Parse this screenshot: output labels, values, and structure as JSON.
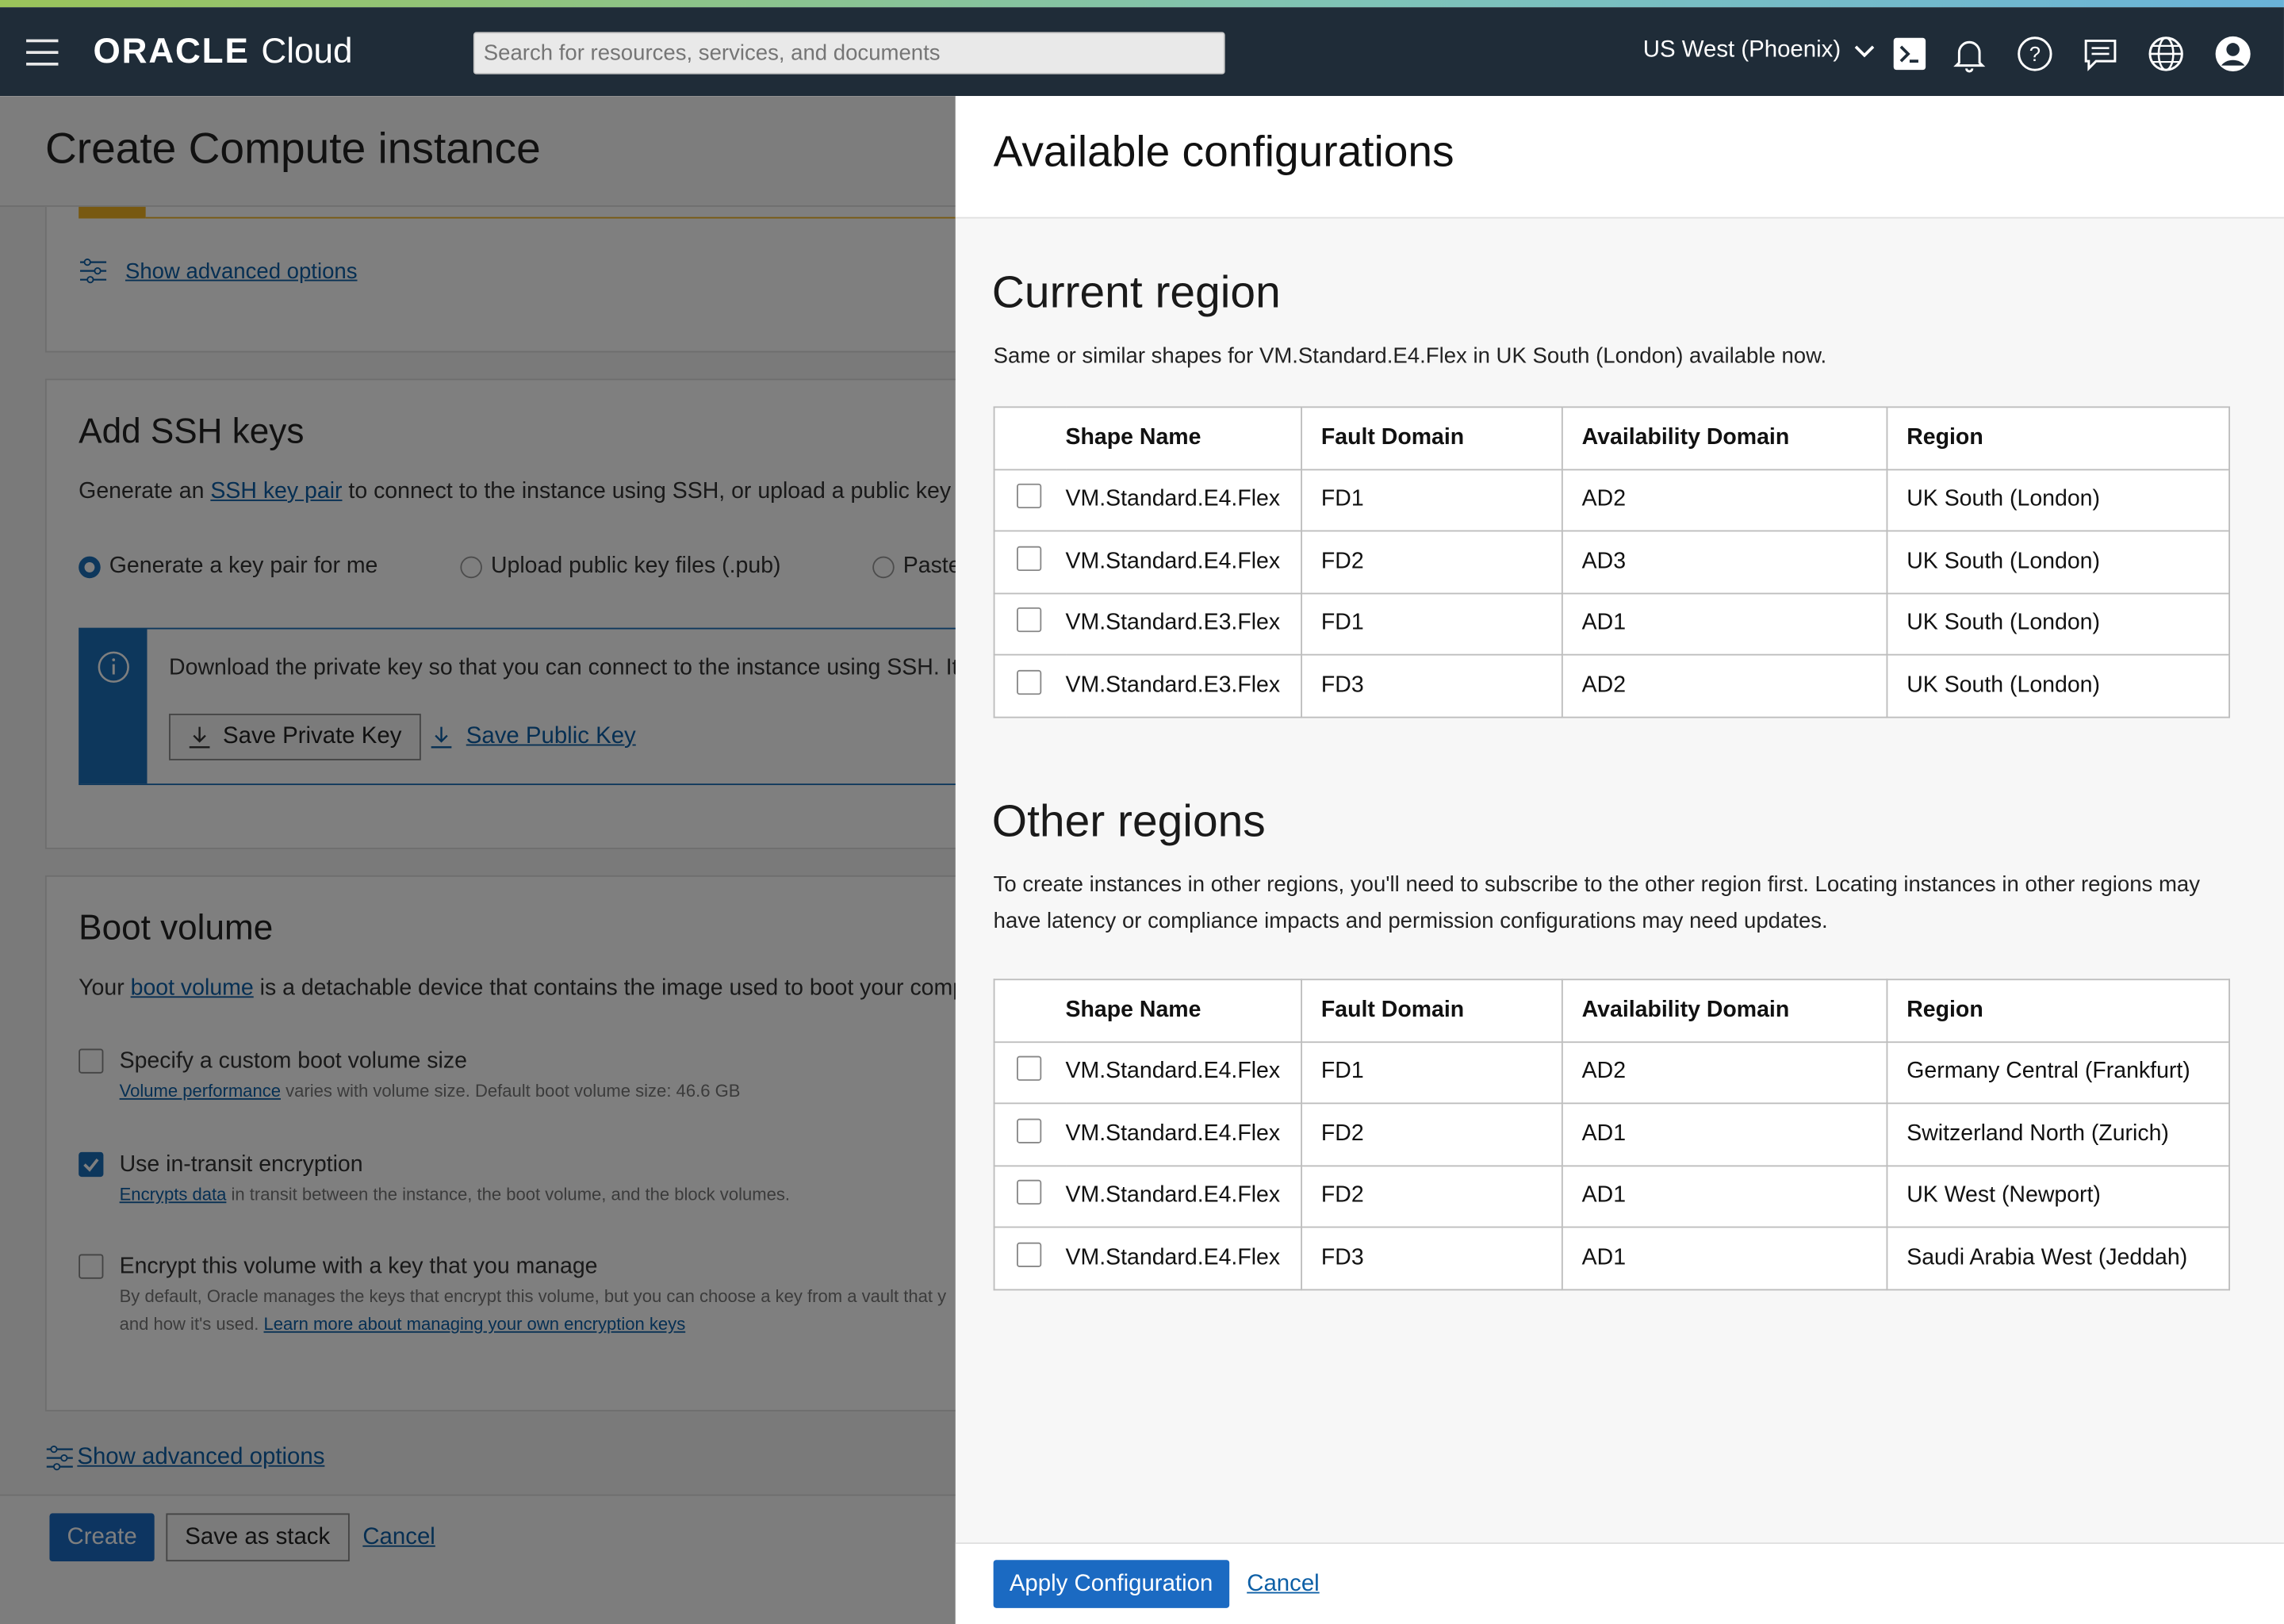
{
  "topbar": {
    "brand": "ORACLE",
    "product": "Cloud",
    "search_placeholder": "Search for resources, services, and documents",
    "region": "US West (Phoenix)",
    "icons": [
      "menu-icon",
      "cloud-shell-icon",
      "bell-icon",
      "help-icon",
      "chat-icon",
      "globe-icon",
      "profile-icon"
    ]
  },
  "page": {
    "title": "Create Compute instance",
    "advanced_link_top": "Show advanced options",
    "ssh": {
      "heading": "Add SSH keys",
      "desc_prefix": "Generate an ",
      "desc_link": "SSH key pair",
      "desc_suffix": " to connect to the instance using SSH, or upload a public key t",
      "options": [
        "Generate a key pair for me",
        "Upload public key files (.pub)",
        "Paste"
      ],
      "info_text": "Download the private key so that you can connect to the instance using SSH. It",
      "save_private": "Save Private Key",
      "save_public": "Save Public Key"
    },
    "boot": {
      "heading": "Boot volume",
      "desc_prefix": "Your ",
      "desc_link": "boot volume",
      "desc_suffix": " is a detachable device that contains the image used to boot your comp",
      "opt1_label": "Specify a custom boot volume size",
      "opt1_link": "Volume performance",
      "opt1_help": " varies with volume size. Default boot volume size: 46.6 GB",
      "opt2_label": "Use in-transit encryption",
      "opt2_link": "Encrypts data",
      "opt2_help": " in transit between the instance, the boot volume, and the block volumes.",
      "opt3_label": "Encrypt this volume with a key that you manage",
      "opt3_help1": "By default, Oracle manages the keys that encrypt this volume, but you can choose a key from a vault that y",
      "opt3_help2": "and how it's used. ",
      "opt3_link": "Learn more about managing your own encryption keys"
    },
    "advanced_link_bottom": "Show advanced options",
    "buttons": {
      "create": "Create",
      "save_stack": "Save as stack",
      "cancel": "Cancel"
    }
  },
  "panel": {
    "title": "Available configurations",
    "current": {
      "heading": "Current region",
      "desc": "Same or similar shapes for VM.Standard.E4.Flex in UK South (London) available now.",
      "columns": [
        "Shape Name",
        "Fault Domain",
        "Availability Domain",
        "Region"
      ],
      "rows": [
        [
          "VM.Standard.E4.Flex",
          "FD1",
          "AD2",
          "UK South (London)"
        ],
        [
          "VM.Standard.E4.Flex",
          "FD2",
          "AD3",
          "UK South (London)"
        ],
        [
          "VM.Standard.E3.Flex",
          "FD1",
          "AD1",
          "UK South (London)"
        ],
        [
          "VM.Standard.E3.Flex",
          "FD3",
          "AD2",
          "UK South (London)"
        ]
      ]
    },
    "other": {
      "heading": "Other regions",
      "desc_line1": "To create instances in other regions, you'll need to subscribe to the other region first. Locating instances in other regions may",
      "desc_line2": "have latency or compliance impacts and permission configurations may need updates.",
      "columns": [
        "Shape Name",
        "Fault Domain",
        "Availability Domain",
        "Region"
      ],
      "rows": [
        [
          "VM.Standard.E4.Flex",
          "FD1",
          "AD2",
          "Germany Central (Frankfurt)"
        ],
        [
          "VM.Standard.E4.Flex",
          "FD2",
          "AD1",
          "Switzerland North (Zurich)"
        ],
        [
          "VM.Standard.E4.Flex",
          "FD2",
          "AD1",
          "UK West (Newport)"
        ],
        [
          "VM.Standard.E4.Flex",
          "FD3",
          "AD1",
          "Saudi Arabia West (Jeddah)"
        ]
      ]
    },
    "apply": "Apply Configuration",
    "cancel": "Cancel"
  }
}
